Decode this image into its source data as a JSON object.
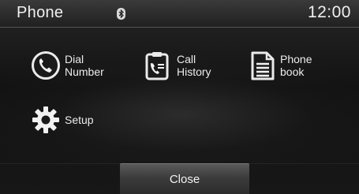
{
  "status_bar": {
    "title": "Phone",
    "time": "12:00",
    "bluetooth_icon": "bluetooth-icon"
  },
  "menu": {
    "items": [
      {
        "label_line1": "Dial",
        "label_line2": "Number",
        "icon": "dial-number-icon"
      },
      {
        "label_line1": "Call",
        "label_line2": "History",
        "icon": "call-history-icon"
      },
      {
        "label_line1": "Phone",
        "label_line2": "book",
        "icon": "phonebook-icon"
      },
      {
        "label_line1": "Setup",
        "label_line2": "",
        "icon": "gear-icon"
      }
    ]
  },
  "footer": {
    "close_label": "Close"
  }
}
